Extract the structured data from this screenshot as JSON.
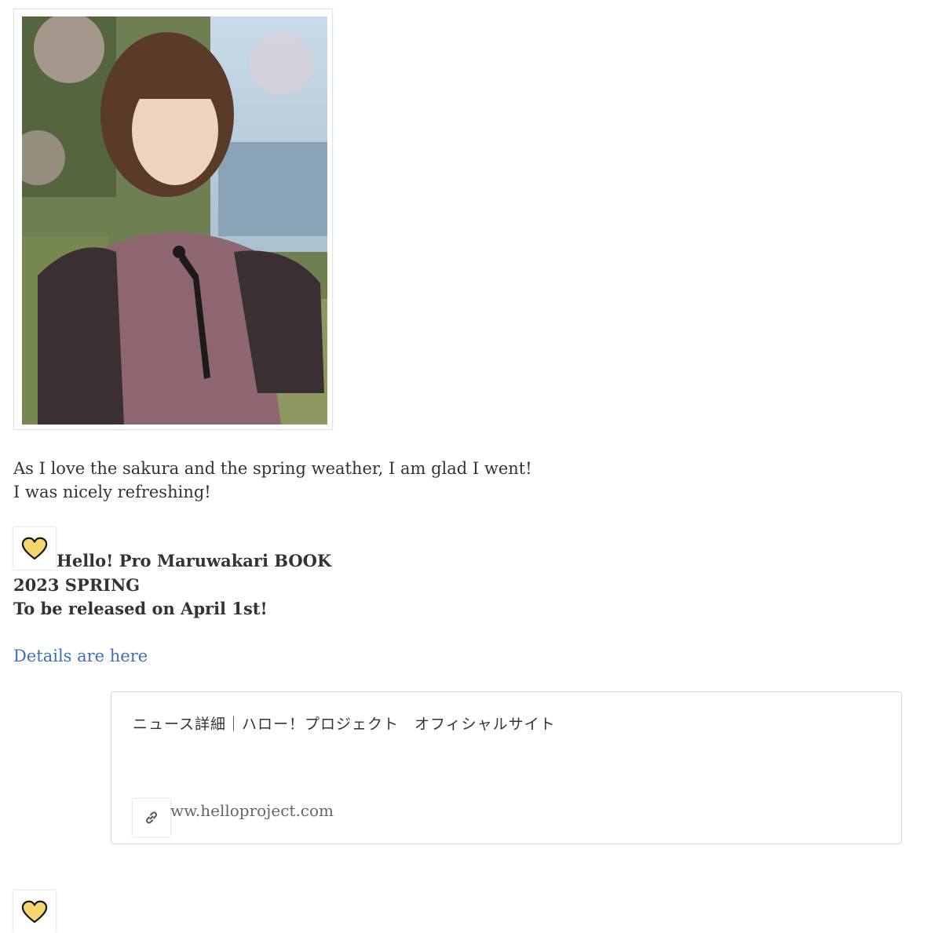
{
  "post": {
    "paragraph_lines": [
      "As I love the sakura and the spring weather, I am glad I went!",
      "I was nicely refreshing!"
    ],
    "announcement_lines": [
      "Hello! Pro Maruwakari BOOK",
      "2023 SPRING",
      "To be released on April 1st!"
    ],
    "details_link": "Details are here"
  },
  "link_card": {
    "title": "ニュース詳細｜ハロー！プロジェクト　オフィシャルサイト",
    "domain": "ww.helloproject.com"
  },
  "icons": {
    "heart": "yellow-heart-icon",
    "link": "link-icon"
  },
  "colors": {
    "heart_fill": "#f5d76e",
    "link_text": "#3f6fb5"
  }
}
